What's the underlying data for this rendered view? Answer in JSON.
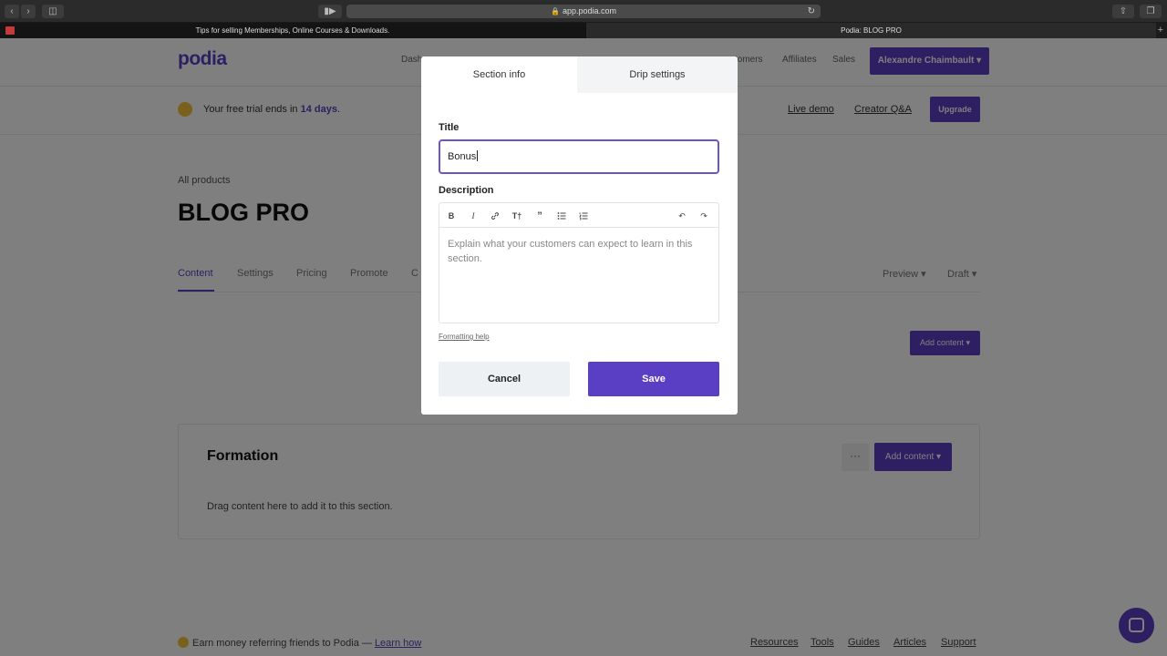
{
  "browser": {
    "url": "app.podia.com",
    "tabs": [
      {
        "title": "Tips for selling Memberships, Online Courses & Downloads."
      },
      {
        "title": "Podia: BLOG PRO"
      }
    ],
    "new_tab": "+"
  },
  "nav": {
    "logo": "podia",
    "links": [
      "Dash",
      "tomers",
      "Affiliates",
      "Sales"
    ],
    "user_button": "Alexandre Chaimbault ▾"
  },
  "trial": {
    "text_prefix": "Your free trial ends in ",
    "days": "14 days",
    "text_suffix": ".",
    "live_demo": "Live demo",
    "creator_qa": "Creator Q&A",
    "upgrade": "Upgrade"
  },
  "product": {
    "breadcrumb": "All products",
    "title": "BLOG PRO",
    "tabs": [
      "Content",
      "Settings",
      "Pricing",
      "Promote",
      "C"
    ],
    "preview": "Preview ▾",
    "draft": "Draft ▾",
    "add_content": "Add content ▾"
  },
  "section": {
    "title": "Formation",
    "more": "···",
    "add_content": "Add content ▾",
    "empty_text": "Drag content here to add it to this section."
  },
  "footer": {
    "referral_text": "Earn money referring friends to Podia — ",
    "learn_how": "Learn how",
    "links": [
      "Resources",
      "Tools",
      "Guides",
      "Articles",
      "Support"
    ]
  },
  "modal": {
    "tabs": [
      "Section info",
      "Drip settings"
    ],
    "title_label": "Title",
    "title_value": "Bonus",
    "description_label": "Description",
    "toolbar_icons": [
      "bold-icon",
      "italic-icon",
      "link-icon",
      "heading-icon",
      "quote-icon",
      "bullet-list-icon",
      "numbered-list-icon",
      "undo-icon",
      "redo-icon"
    ],
    "description_placeholder": "Explain what your customers can expect to learn in this section.",
    "formatting_help": "Formatting help",
    "cancel": "Cancel",
    "save": "Save"
  },
  "colors": {
    "brand": "#5a3fc4",
    "overlay": "rgba(0,0,0,0.5)"
  }
}
